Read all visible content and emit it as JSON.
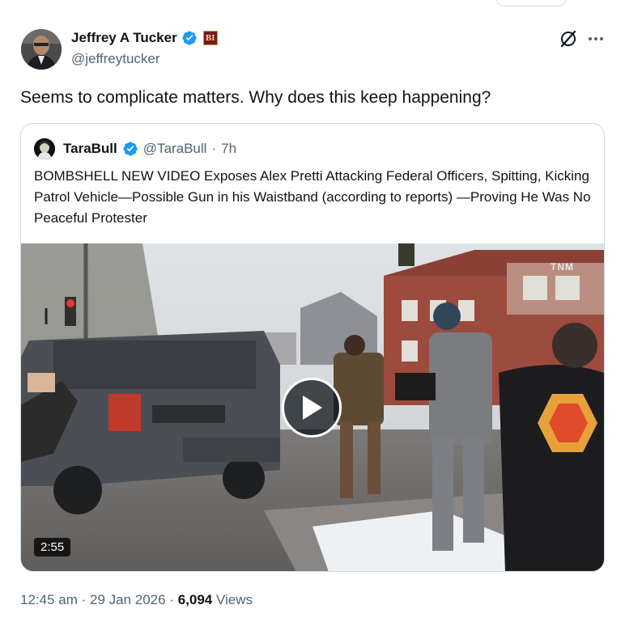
{
  "author": {
    "name": "Jeffrey A Tucker",
    "handle": "@jeffreytucker",
    "affiliation_badge": "BI"
  },
  "tweet": {
    "text": "Seems to complicate matters. Why does this keep happening?"
  },
  "quoted": {
    "name": "TaraBull",
    "handle": "@TaraBull",
    "separator": "·",
    "time": "7h",
    "text": "BOMBSHELL NEW VIDEO Exposes Alex Pretti Attacking Federal Officers, Spitting, Kicking Patrol Vehicle—Possible Gun in his Waistband (according to reports) —Proving He Was No Peaceful Protester",
    "video": {
      "duration": "2:55",
      "watermark": "TNM"
    }
  },
  "meta": {
    "time": "12:45 am",
    "sep1": " · ",
    "date": "29 Jan 2026",
    "sep2": " · ",
    "views_count": "6,094",
    "views_label": " Views"
  },
  "colors": {
    "verified": "#1d9bf0",
    "text_primary": "#0f1419",
    "text_secondary": "#536471",
    "border": "#cfd9de"
  },
  "icons": [
    "verified-badge-icon",
    "affiliation-badge-icon",
    "grok-icon",
    "more-icon",
    "play-icon"
  ]
}
